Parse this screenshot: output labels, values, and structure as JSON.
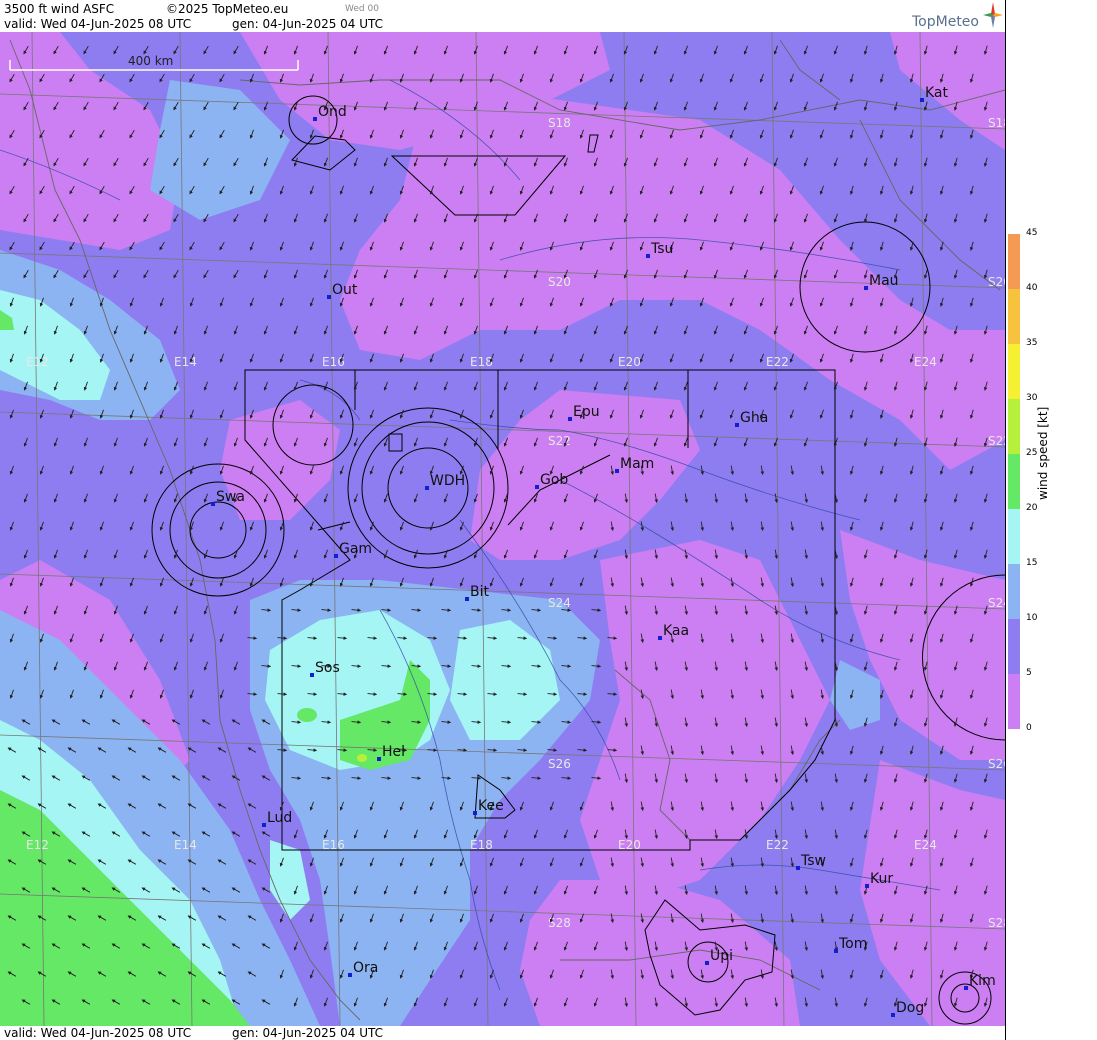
{
  "header": {
    "title": "3500 ft wind ASFC",
    "copyright": "©2025 TopMeteo.eu",
    "day_tag": "Wed 00",
    "valid": "valid:  Wed  04-Jun-2025  08 UTC",
    "generated": "gen: 04-Jun-2025 04 UTC",
    "brand": "TopMeteo"
  },
  "footer": {
    "valid": "valid:  Wed  04-Jun-2025  08 UTC",
    "generated": "gen: 04-Jun-2025 04 UTC"
  },
  "scale_bar": {
    "label": "400 km"
  },
  "legend": {
    "title": "wind speed [kt]",
    "ticks": [
      "45",
      "40",
      "35",
      "30",
      "25",
      "20",
      "15",
      "10",
      "5",
      "0"
    ],
    "colors": {
      "0": "#cc7ff2",
      "5": "#8d7df0",
      "10": "#8cb3f2",
      "15": "#a6f5f5",
      "20": "#65e865",
      "25": "#b6f03c",
      "30": "#f5f032",
      "35": "#f7c23d",
      "40": "#f59a55",
      "45": "#f2706a"
    }
  },
  "graticule": {
    "longitudes": [
      "E12",
      "E14",
      "E16",
      "E18",
      "E20",
      "E22",
      "E24"
    ],
    "latitudes": [
      "S18",
      "S20",
      "S22",
      "S24",
      "S26",
      "S28"
    ]
  },
  "places": [
    {
      "name": "Ond"
    },
    {
      "name": "Kat"
    },
    {
      "name": "Tsu"
    },
    {
      "name": "Mau"
    },
    {
      "name": "Out"
    },
    {
      "name": "Epu"
    },
    {
      "name": "Gha"
    },
    {
      "name": "Mam"
    },
    {
      "name": "Gob"
    },
    {
      "name": "WDH"
    },
    {
      "name": "Swa"
    },
    {
      "name": "Gam"
    },
    {
      "name": "Bit"
    },
    {
      "name": "Kaa"
    },
    {
      "name": "Sos"
    },
    {
      "name": "Hel"
    },
    {
      "name": "Kee"
    },
    {
      "name": "Lud"
    },
    {
      "name": "Tsw"
    },
    {
      "name": "Kur"
    },
    {
      "name": "Tom"
    },
    {
      "name": "Upi"
    },
    {
      "name": "Ora"
    },
    {
      "name": "Kim"
    },
    {
      "name": "Dog"
    }
  ]
}
